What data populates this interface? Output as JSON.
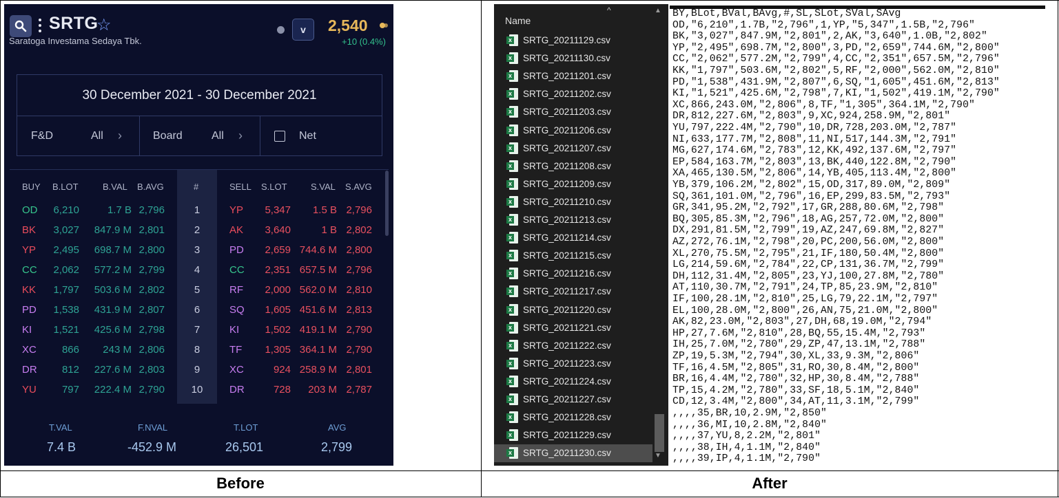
{
  "captions": {
    "before": "Before",
    "after": "After"
  },
  "app": {
    "ticker": "SRTG",
    "company": "Saratoga Investama Sedaya Tbk.",
    "v_button": "v",
    "price": "2,540",
    "change": "+10 (0.4%)",
    "date_range": "30 December 2021 - 30 December 2021",
    "filters": {
      "fd_label": "F&D",
      "fd_value": "All",
      "board_label": "Board",
      "board_value": "All",
      "net_label": "Net"
    },
    "headers": [
      "BUY",
      "B.LOT",
      "B.VAL",
      "B.AVG",
      "#",
      "SELL",
      "S.LOT",
      "S.VAL",
      "S.AVG"
    ],
    "rows": [
      {
        "buy": "OD",
        "blot": "6,210",
        "bval": "1.7 B",
        "bavg": "2,796",
        "n": "1",
        "sell": "YP",
        "slot": "5,347",
        "sval": "1.5 B",
        "savg": "2,796"
      },
      {
        "buy": "BK",
        "blot": "3,027",
        "bval": "847.9 M",
        "bavg": "2,801",
        "n": "2",
        "sell": "AK",
        "slot": "3,640",
        "sval": "1 B",
        "savg": "2,802"
      },
      {
        "buy": "YP",
        "blot": "2,495",
        "bval": "698.7 M",
        "bavg": "2,800",
        "n": "3",
        "sell": "PD",
        "slot": "2,659",
        "sval": "744.6 M",
        "savg": "2,800"
      },
      {
        "buy": "CC",
        "blot": "2,062",
        "bval": "577.2 M",
        "bavg": "2,799",
        "n": "4",
        "sell": "CC",
        "slot": "2,351",
        "sval": "657.5 M",
        "savg": "2,796"
      },
      {
        "buy": "KK",
        "blot": "1,797",
        "bval": "503.6 M",
        "bavg": "2,802",
        "n": "5",
        "sell": "RF",
        "slot": "2,000",
        "sval": "562.0 M",
        "savg": "2,810"
      },
      {
        "buy": "PD",
        "blot": "1,538",
        "bval": "431.9 M",
        "bavg": "2,807",
        "n": "6",
        "sell": "SQ",
        "slot": "1,605",
        "sval": "451.6 M",
        "savg": "2,813"
      },
      {
        "buy": "KI",
        "blot": "1,521",
        "bval": "425.6 M",
        "bavg": "2,798",
        "n": "7",
        "sell": "KI",
        "slot": "1,502",
        "sval": "419.1 M",
        "savg": "2,790"
      },
      {
        "buy": "XC",
        "blot": "866",
        "bval": "243 M",
        "bavg": "2,806",
        "n": "8",
        "sell": "TF",
        "slot": "1,305",
        "sval": "364.1 M",
        "savg": "2,790"
      },
      {
        "buy": "DR",
        "blot": "812",
        "bval": "227.6 M",
        "bavg": "2,803",
        "n": "9",
        "sell": "XC",
        "slot": "924",
        "sval": "258.9 M",
        "savg": "2,801"
      },
      {
        "buy": "YU",
        "blot": "797",
        "bval": "222.4 M",
        "bavg": "2,790",
        "n": "10",
        "sell": "DR",
        "slot": "728",
        "sval": "203 M",
        "savg": "2,787"
      }
    ],
    "buy_colors": [
      "#36c48c",
      "#ea4c5c",
      "#ea4c5c",
      "#36c48c",
      "#ea4c5c",
      "#c77df0",
      "#c77df0",
      "#c77df0",
      "#c77df0",
      "#ea4c5c"
    ],
    "sell_colors": [
      "#ea4c5c",
      "#ea4c5c",
      "#c77df0",
      "#36c48c",
      "#c77df0",
      "#c77df0",
      "#c77df0",
      "#c77df0",
      "#c77df0",
      "#c77df0"
    ],
    "footer": {
      "tval_label": "T.VAL",
      "tval": "7.4 B",
      "fnval_label": "F.NVAL",
      "fnval": "-452.9 M",
      "tlot_label": "T.LOT",
      "tlot": "26,501",
      "avg_label": "AVG",
      "avg": "2,799"
    }
  },
  "explorer": {
    "header": "Name",
    "files": [
      "SRTG_20211129.csv",
      "SRTG_20211130.csv",
      "SRTG_20211201.csv",
      "SRTG_20211202.csv",
      "SRTG_20211203.csv",
      "SRTG_20211206.csv",
      "SRTG_20211207.csv",
      "SRTG_20211208.csv",
      "SRTG_20211209.csv",
      "SRTG_20211210.csv",
      "SRTG_20211213.csv",
      "SRTG_20211214.csv",
      "SRTG_20211215.csv",
      "SRTG_20211216.csv",
      "SRTG_20211217.csv",
      "SRTG_20211220.csv",
      "SRTG_20211221.csv",
      "SRTG_20211222.csv",
      "SRTG_20211223.csv",
      "SRTG_20211224.csv",
      "SRTG_20211227.csv",
      "SRTG_20211228.csv",
      "SRTG_20211229.csv",
      "SRTG_20211230.csv"
    ],
    "selected": "SRTG_20211230.csv"
  },
  "csv_lines": [
    "BY,BLot,BVal,BAvg,#,SL,SLot,SVal,SAvg",
    "OD,\"6,210\",1.7B,\"2,796\",1,YP,\"5,347\",1.5B,\"2,796\"",
    "BK,\"3,027\",847.9M,\"2,801\",2,AK,\"3,640\",1.0B,\"2,802\"",
    "YP,\"2,495\",698.7M,\"2,800\",3,PD,\"2,659\",744.6M,\"2,800\"",
    "CC,\"2,062\",577.2M,\"2,799\",4,CC,\"2,351\",657.5M,\"2,796\"",
    "KK,\"1,797\",503.6M,\"2,802\",5,RF,\"2,000\",562.0M,\"2,810\"",
    "PD,\"1,538\",431.9M,\"2,807\",6,SQ,\"1,605\",451.6M,\"2,813\"",
    "KI,\"1,521\",425.6M,\"2,798\",7,KI,\"1,502\",419.1M,\"2,790\"",
    "XC,866,243.0M,\"2,806\",8,TF,\"1,305\",364.1M,\"2,790\"",
    "DR,812,227.6M,\"2,803\",9,XC,924,258.9M,\"2,801\"",
    "YU,797,222.4M,\"2,790\",10,DR,728,203.0M,\"2,787\"",
    "NI,633,177.7M,\"2,808\",11,NI,517,144.3M,\"2,791\"",
    "MG,627,174.6M,\"2,783\",12,KK,492,137.6M,\"2,797\"",
    "EP,584,163.7M,\"2,803\",13,BK,440,122.8M,\"2,790\"",
    "XA,465,130.5M,\"2,806\",14,YB,405,113.4M,\"2,800\"",
    "YB,379,106.2M,\"2,802\",15,OD,317,89.0M,\"2,809\"",
    "SQ,361,101.0M,\"2,796\",16,EP,299,83.5M,\"2,793\"",
    "GR,341,95.2M,\"2,792\",17,GR,288,80.6M,\"2,798\"",
    "BQ,305,85.3M,\"2,796\",18,AG,257,72.0M,\"2,800\"",
    "DX,291,81.5M,\"2,799\",19,AZ,247,69.8M,\"2,827\"",
    "AZ,272,76.1M,\"2,798\",20,PC,200,56.0M,\"2,800\"",
    "XL,270,75.5M,\"2,795\",21,IF,180,50.4M,\"2,800\"",
    "LG,214,59.6M,\"2,784\",22,CP,131,36.7M,\"2,799\"",
    "DH,112,31.4M,\"2,805\",23,YJ,100,27.8M,\"2,780\"",
    "AT,110,30.7M,\"2,791\",24,TP,85,23.9M,\"2,810\"",
    "IF,100,28.1M,\"2,810\",25,LG,79,22.1M,\"2,797\"",
    "EL,100,28.0M,\"2,800\",26,AN,75,21.0M,\"2,800\"",
    "AK,82,23.0M,\"2,803\",27,DH,68,19.0M,\"2,794\"",
    "HP,27,7.6M,\"2,810\",28,BQ,55,15.4M,\"2,793\"",
    "IH,25,7.0M,\"2,780\",29,ZP,47,13.1M,\"2,788\"",
    "ZP,19,5.3M,\"2,794\",30,XL,33,9.3M,\"2,806\"",
    "TF,16,4.5M,\"2,805\",31,RO,30,8.4M,\"2,800\"",
    "BR,16,4.4M,\"2,780\",32,HP,30,8.4M,\"2,788\"",
    "TP,15,4.2M,\"2,780\",33,SF,18,5.1M,\"2,840\"",
    "CD,12,3.4M,\"2,800\",34,AT,11,3.1M,\"2,799\"",
    ",,,,35,BR,10,2.9M,\"2,850\"",
    ",,,,36,MI,10,2.8M,\"2,840\"",
    ",,,,37,YU,8,2.2M,\"2,801\"",
    ",,,,38,IH,4,1.1M,\"2,840\"",
    ",,,,39,IP,4,1.1M,\"2,790\""
  ]
}
